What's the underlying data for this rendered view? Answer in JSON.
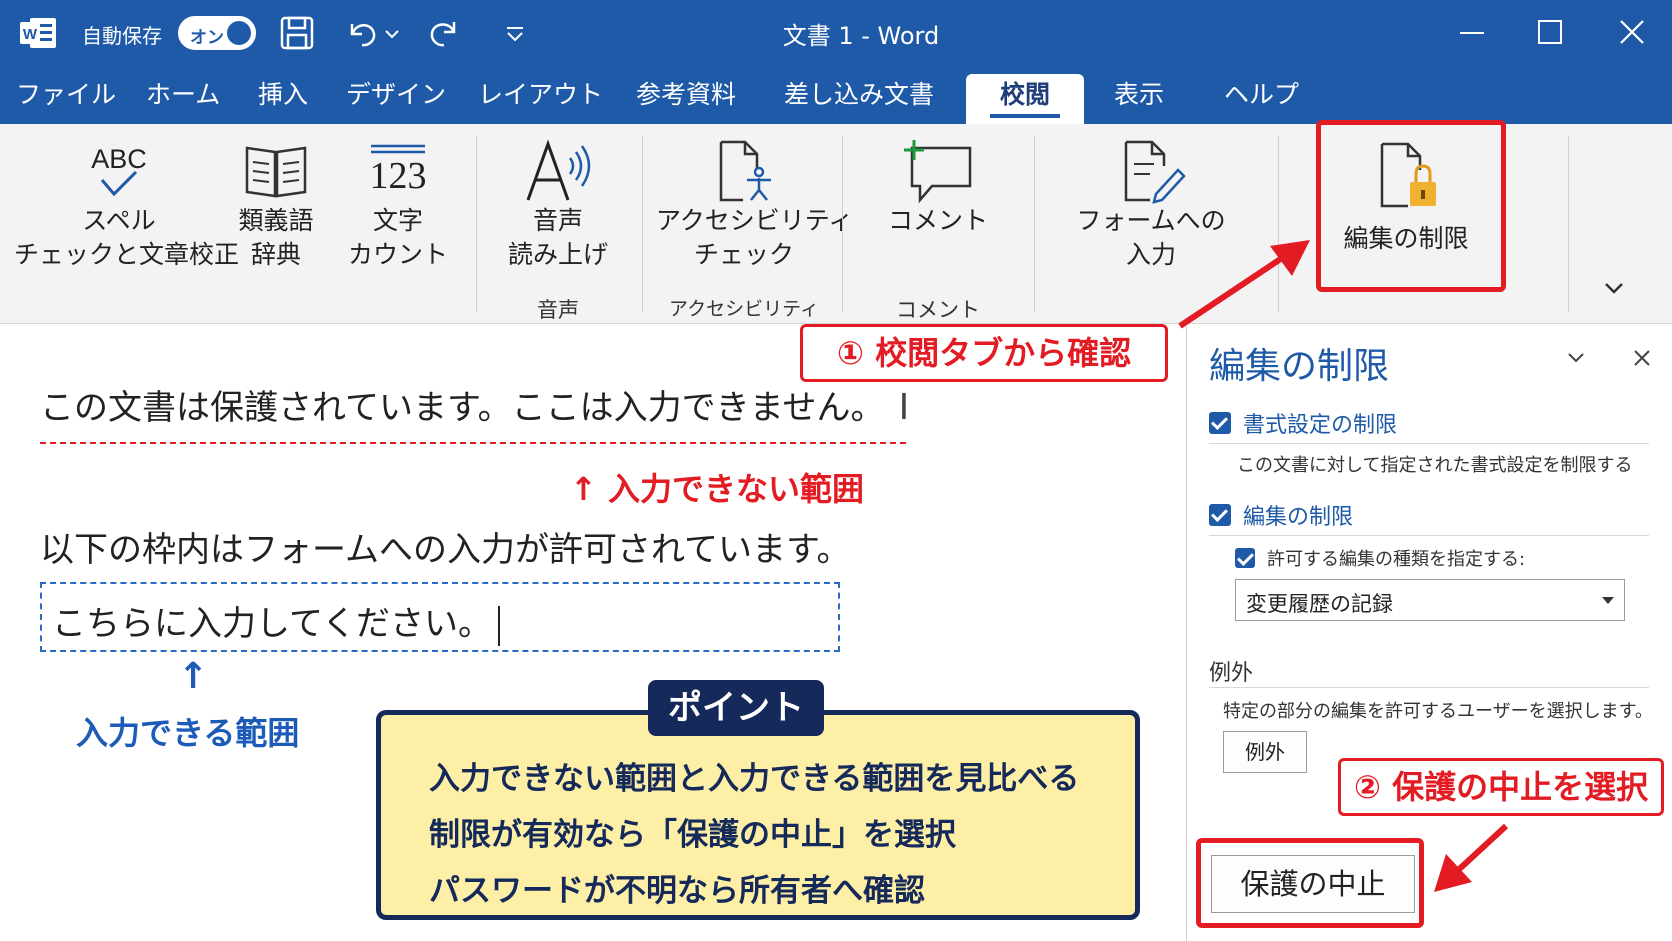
{
  "titlebar": {
    "autosave_label": "自動保存",
    "autosave_state": "オン",
    "doc_title": "文書 1  -  Word"
  },
  "tabs": [
    {
      "label": "ファイル"
    },
    {
      "label": "ホーム"
    },
    {
      "label": "挿入"
    },
    {
      "label": "デザイン"
    },
    {
      "label": "レイアウト"
    },
    {
      "label": "参考資料"
    },
    {
      "label": "差し込み文書"
    },
    {
      "label": "校閲",
      "active": true
    },
    {
      "label": "表示"
    },
    {
      "label": "ヘルプ"
    }
  ],
  "ribbon": {
    "spell": {
      "icon_text": "ABC",
      "line1": "スペル",
      "line2": "チェックと文章校正"
    },
    "thesaurus": {
      "line1": "類義語",
      "line2": "辞典"
    },
    "wordcount": {
      "icon_text": "123",
      "line1": "文字",
      "line2": "カウント"
    },
    "readaloud": {
      "line1": "音声",
      "line2": "読み上げ",
      "group": "音声"
    },
    "accessibility": {
      "line1": "アクセシビリティ",
      "line2": "チェック",
      "group": "アクセシビリティ"
    },
    "comment": {
      "line1": "コメント",
      "group": "コメント"
    },
    "form_input": {
      "line1": "フォームへの",
      "line2": "入力"
    },
    "restrict_editing": {
      "label": "編集の制限"
    }
  },
  "document": {
    "protected_text": "この文書は保護されています。ここは入力できません。",
    "allowed_intro": "以下の枠内はフォームへの入力が許可されています。",
    "form_text": "こちらに入力してください。"
  },
  "annotations": {
    "not_editable": "↑ 入力できない範囲",
    "editable_arrow": "↑",
    "editable": "入力できる範囲",
    "step1": "① 校閲タブから確認",
    "step2": "② 保護の中止を選択"
  },
  "point": {
    "tag": "ポイント",
    "lines": [
      "入力できない範囲と入力できる範囲を見比べる",
      "制限が有効なら「保護の中止」を選択",
      "パスワードが不明なら所有者へ確認"
    ]
  },
  "pane": {
    "title": "編集の制限",
    "format_restrict": "書式設定の制限",
    "format_desc": "この文書に対して指定された書式設定を制限する",
    "edit_restrict": "編集の制限",
    "allow_type": "許可する編集の種類を指定する:",
    "edit_type_value": "変更履歴の記録",
    "exceptions_heading": "例外",
    "exceptions_desc": "特定の部分の編集を許可するユーザーを選択します。",
    "exceptions_button": "例外",
    "stop_protection_button": "保護の中止"
  },
  "colors": {
    "title_blue": "#1f5aa8",
    "highlight_red": "#e31b23",
    "point_navy": "#15295a",
    "point_yellow": "#fdf0a6"
  }
}
